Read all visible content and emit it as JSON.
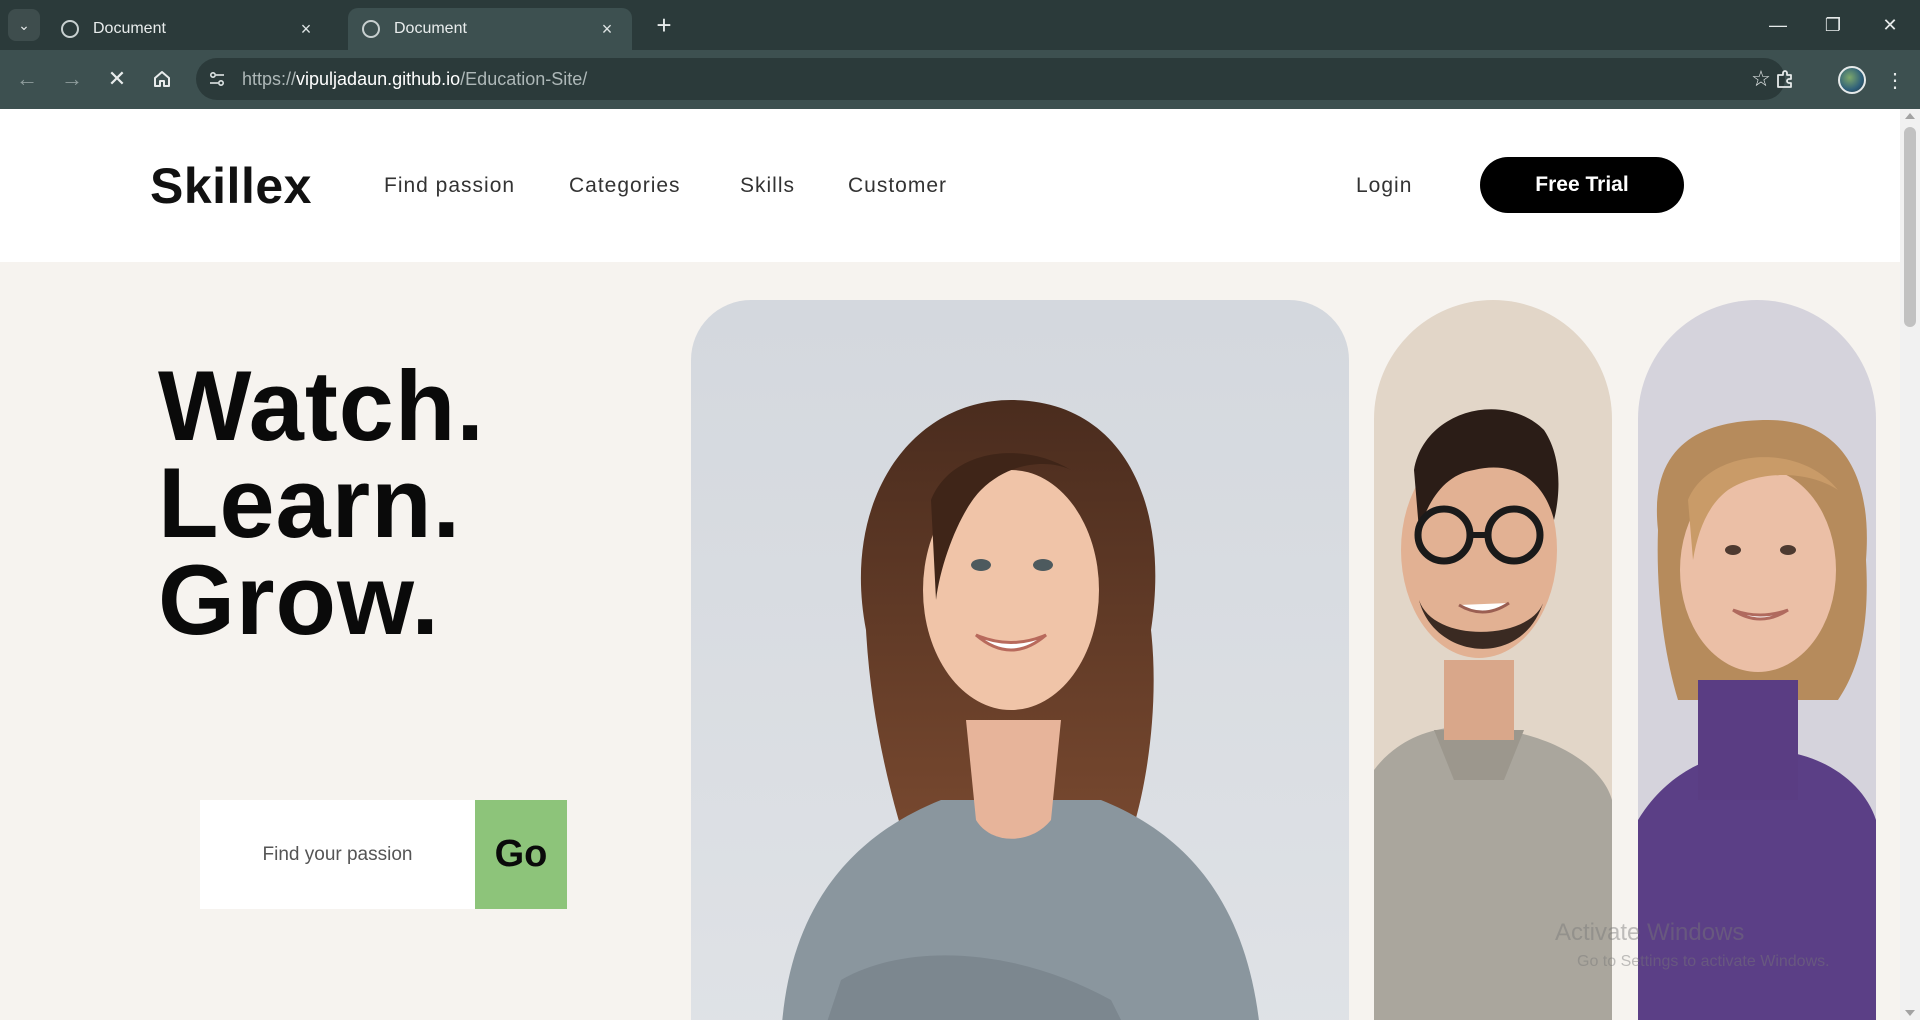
{
  "browser": {
    "tabs": [
      {
        "title": "Document",
        "active": false
      },
      {
        "title": "Document",
        "active": true
      }
    ],
    "url_scheme": "https://",
    "url_host": "vipuljadaun.github.io",
    "url_path": "/Education-Site/"
  },
  "header": {
    "logo": "Skillex",
    "nav": [
      "Find passion",
      "Categories",
      "Skills",
      "Customer"
    ],
    "login": "Login",
    "cta": "Free Trial"
  },
  "hero": {
    "lines": [
      "Watch.",
      "Learn.",
      "Grow."
    ],
    "search_placeholder": "Find your passion",
    "go_label": "Go"
  },
  "watermark": {
    "title": "Activate Windows",
    "subtitle": "Go to Settings to activate Windows."
  },
  "colors": {
    "chrome_dark": "#2b3a3a",
    "chrome_toolbar": "#3d5050",
    "page_bg": "#f6f3ef",
    "cta_bg": "#000000",
    "go_bg": "#8dc47a"
  }
}
